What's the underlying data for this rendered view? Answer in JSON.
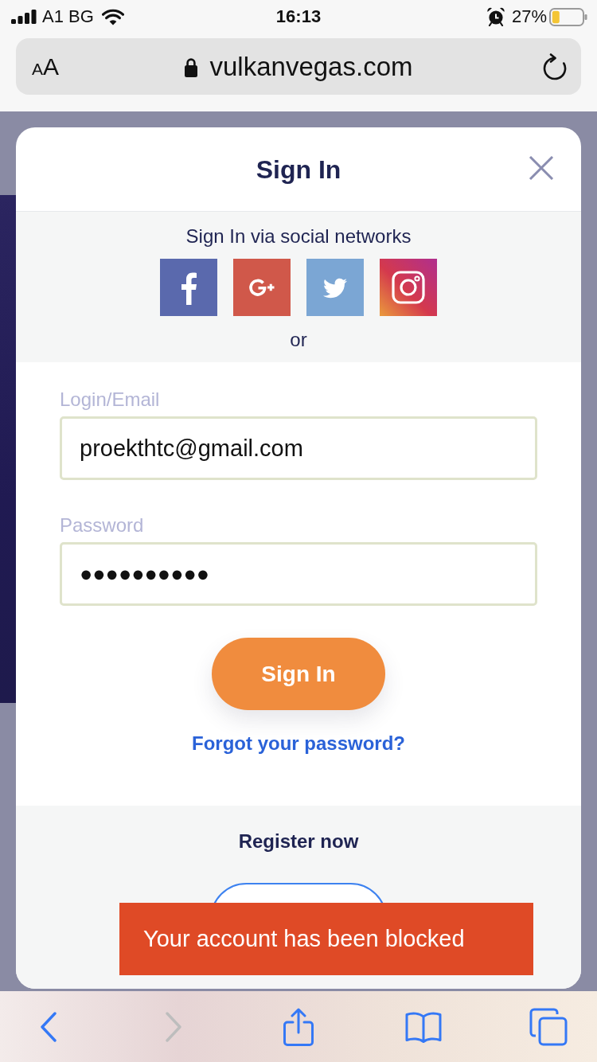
{
  "status_bar": {
    "carrier": "A1 BG",
    "time": "16:13",
    "battery": "27%"
  },
  "address_bar": {
    "text_size_button": {
      "small": "A",
      "large": "A"
    },
    "url": "vulkanvegas.com"
  },
  "modal": {
    "title": "Sign In",
    "social_heading": "Sign In via social networks",
    "social_buttons": [
      {
        "kind": "facebook"
      },
      {
        "kind": "google_plus"
      },
      {
        "kind": "twitter"
      },
      {
        "kind": "instagram"
      }
    ],
    "separator": "or",
    "fields": [
      {
        "kind": "email",
        "label": "Login/Email",
        "value": "proekthtc@gmail.com"
      },
      {
        "kind": "password",
        "label": "Password",
        "value": "●●●●●●●●●●"
      }
    ],
    "submit_button": "Sign In",
    "forgot_link": "Forgot your password?",
    "register_heading": "Register now"
  },
  "toast": {
    "message": "Your account has been blocked"
  },
  "toolbar": {
    "buttons": [
      {
        "kind": "back",
        "disabled": false
      },
      {
        "kind": "forward",
        "disabled": true
      },
      {
        "kind": "share",
        "disabled": false
      },
      {
        "kind": "bookmarks",
        "disabled": false
      },
      {
        "kind": "tabs",
        "disabled": false
      }
    ]
  }
}
